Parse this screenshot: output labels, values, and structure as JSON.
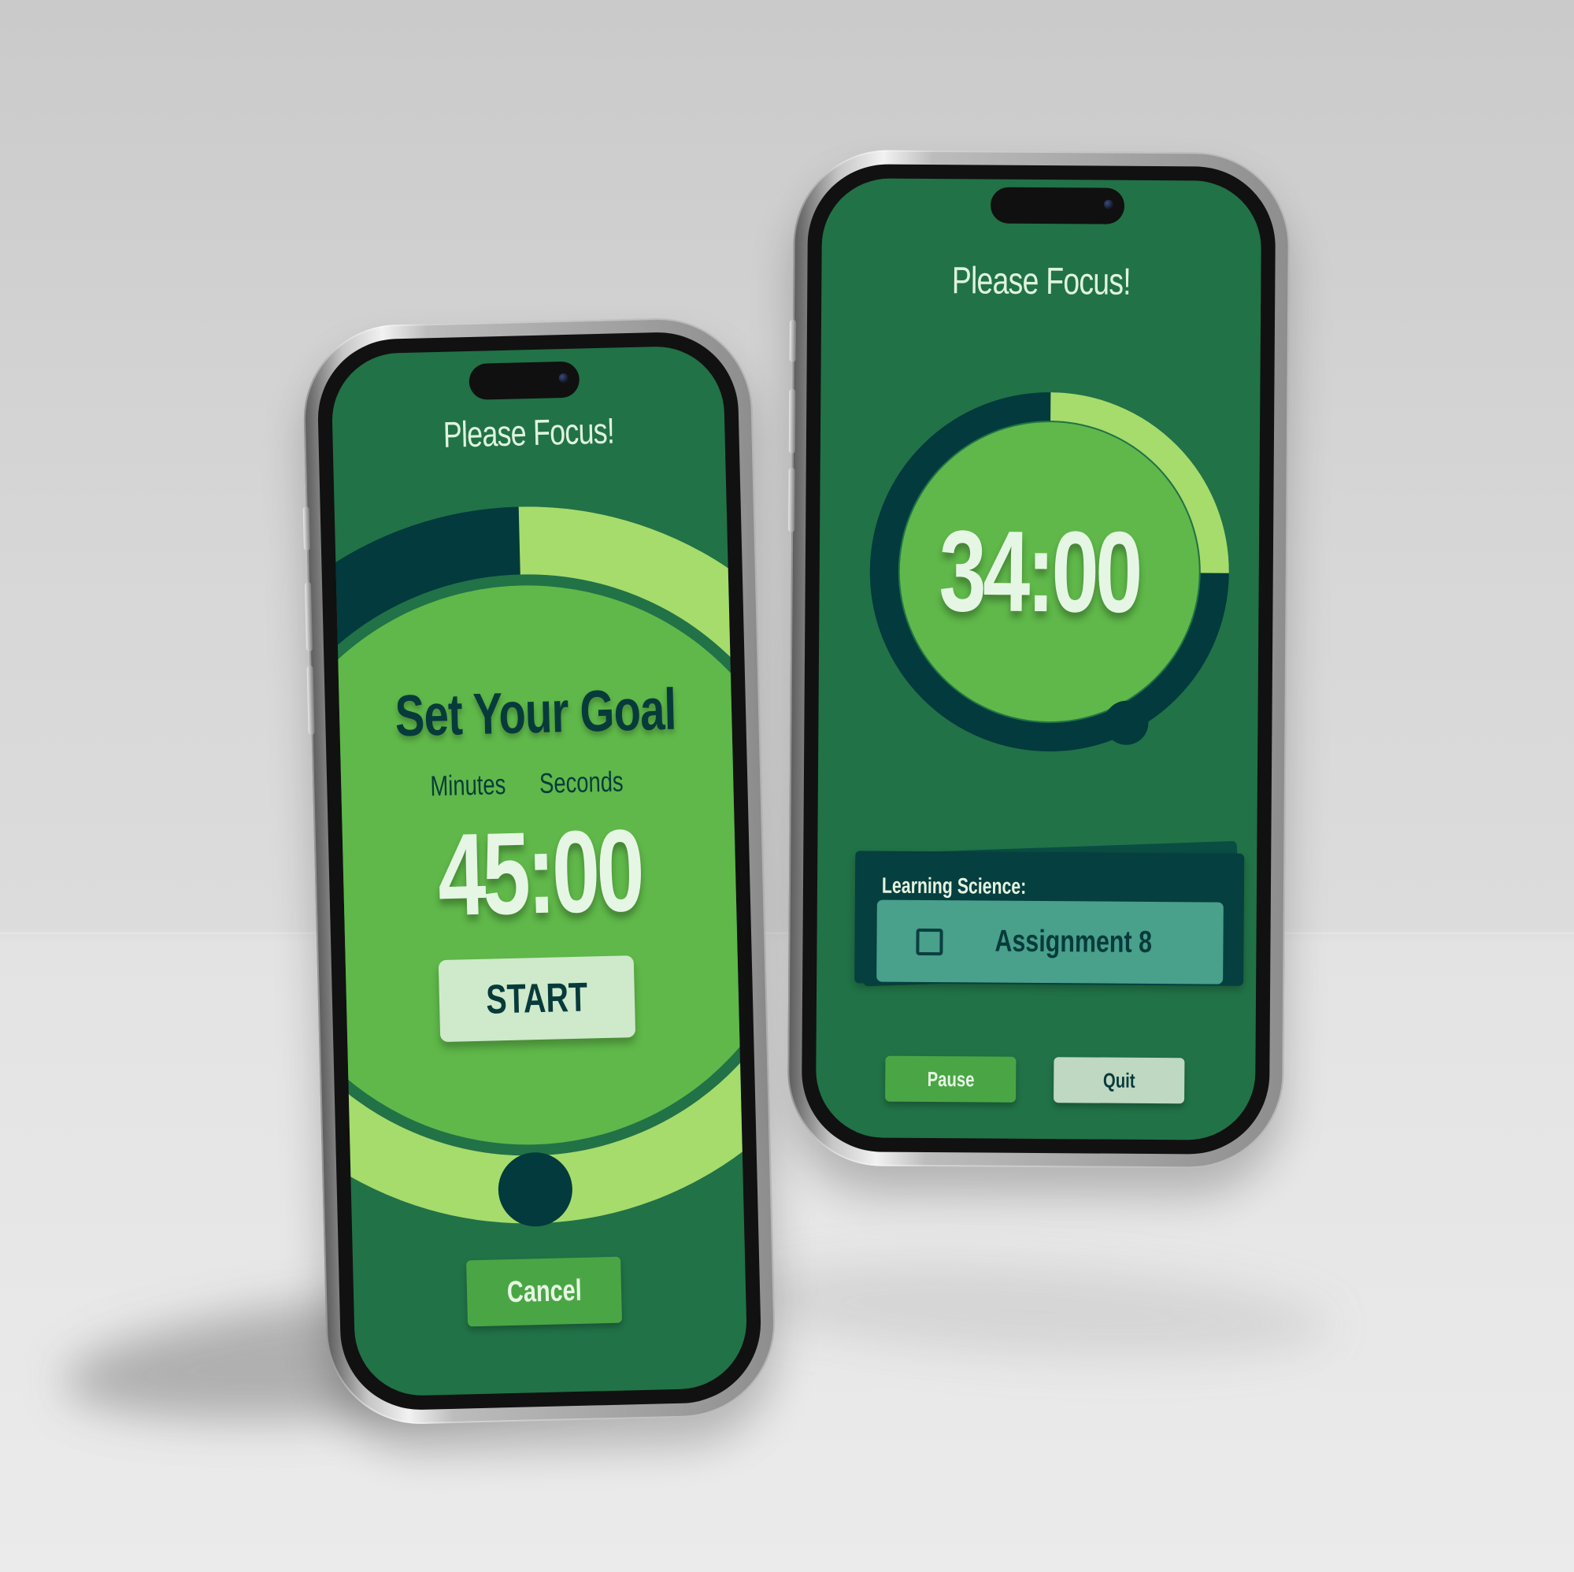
{
  "colors": {
    "screen_background": "#217247",
    "primary_green": "#5fb849",
    "light_progress": "#a6dc6b",
    "dark_track": "#023a3d",
    "light_text": "#e6f6e4",
    "start_button": "#cfe9cb",
    "task_card": "#063f3f",
    "task_row": "#49a08b"
  },
  "left_phone": {
    "header": "Please Focus!",
    "goal_heading": "Set Your Goal",
    "minutes_label": "Minutes",
    "seconds_label": "Seconds",
    "time_value": "45:00",
    "start_label": "START",
    "cancel_label": "Cancel",
    "progress_fraction": 0.62
  },
  "right_phone": {
    "header": "Please Focus!",
    "time_value": "34:00",
    "task_heading": "Learning Science:",
    "task_name": "Assignment 8",
    "pause_label": "Pause",
    "quit_label": "Quit",
    "progress_fraction": 0.25
  },
  "icons": {
    "task_checkbox": "checkbox-icon",
    "front_camera": "camera-icon"
  }
}
